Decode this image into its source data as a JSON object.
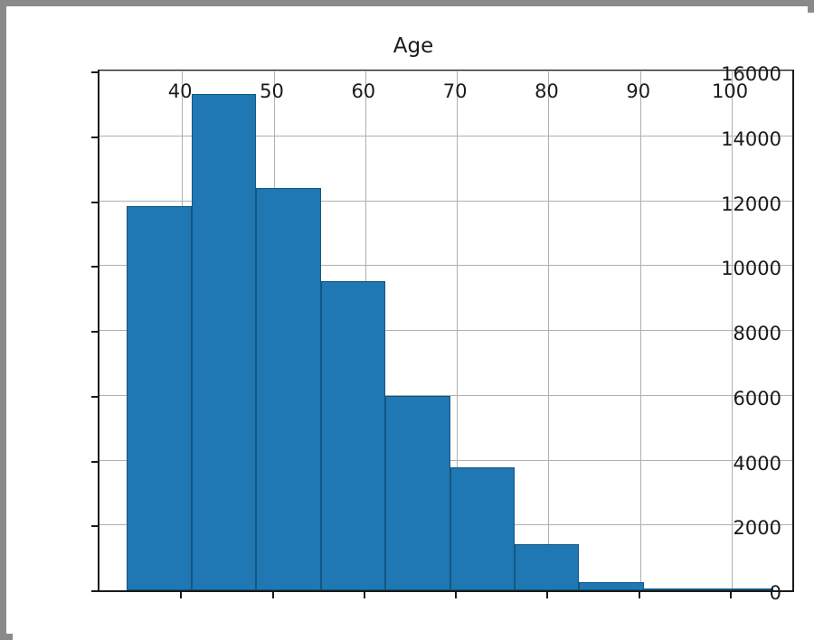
{
  "figure": {
    "title": "Age",
    "background_color": "#ffffff",
    "frame_color": "#8a8a8a",
    "bar_color": "#1f77b4",
    "bar_edge_color": "#14567f",
    "grid_color": "#b0b0b0",
    "axis_color": "#1a1a1a"
  },
  "chart_data": {
    "type": "bar",
    "title": "Age",
    "xlabel": "",
    "ylabel": "",
    "grid": true,
    "legend": null,
    "xlim": [
      31.0,
      107.0
    ],
    "ylim": [
      0,
      16120
    ],
    "xticks": [
      40,
      50,
      60,
      70,
      80,
      90,
      100
    ],
    "xtick_labels": [
      "40",
      "50",
      "60",
      "70",
      "80",
      "90",
      "100"
    ],
    "yticks": [
      0,
      2000,
      4000,
      6000,
      8000,
      10000,
      12000,
      14000,
      16000
    ],
    "ytick_labels": [
      "0",
      "2000",
      "4000",
      "6000",
      "8000",
      "10000",
      "12000",
      "14000",
      "16000"
    ],
    "bin_edges": [
      34.0,
      41.05,
      48.1,
      55.15,
      62.2,
      69.25,
      76.3,
      83.35,
      90.4,
      97.45,
      104.5
    ],
    "categories": [
      "34.0-41.1",
      "41.1-48.1",
      "48.1-55.2",
      "55.2-62.2",
      "62.2-69.3",
      "69.3-76.3",
      "76.3-83.4",
      "83.4-90.4",
      "90.4-97.5",
      "97.5-104.5"
    ],
    "values": [
      11850,
      15300,
      12400,
      9550,
      6000,
      3800,
      1420,
      240,
      60,
      20
    ]
  }
}
